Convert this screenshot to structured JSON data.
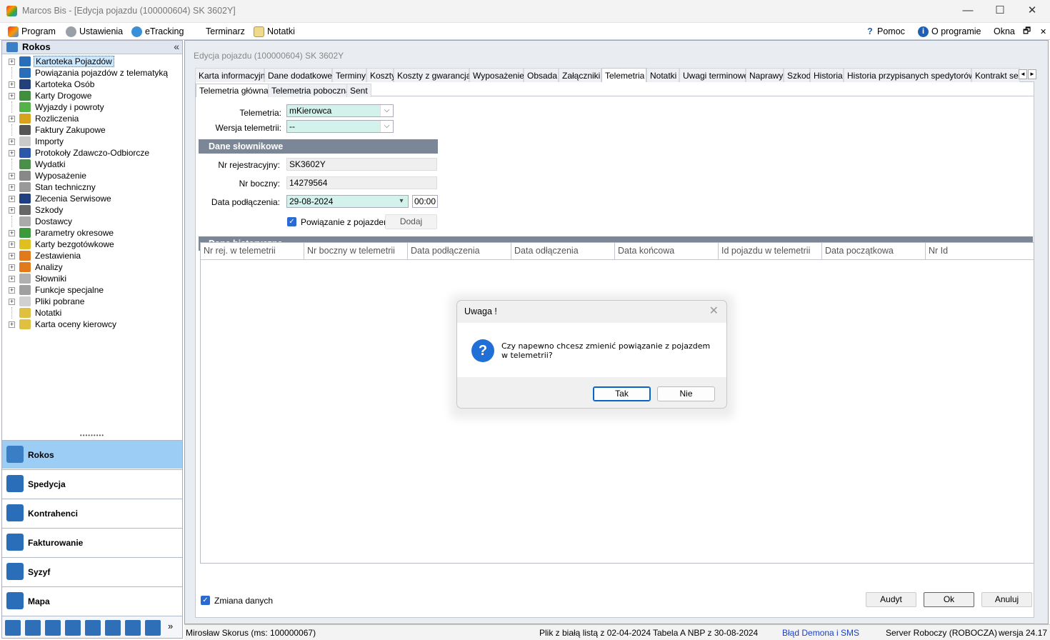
{
  "window": {
    "title": "Marcos Bis - [Edycja pojazdu (100000604) SK 3602Y]",
    "controls": {
      "minimize": "—",
      "maximize": "☐",
      "close": "✕"
    }
  },
  "menu": {
    "left": [
      {
        "label": "Program",
        "icon": "program-icon"
      },
      {
        "label": "Ustawienia",
        "icon": "gear-icon"
      },
      {
        "label": "eTracking",
        "icon": "globe-icon"
      },
      {
        "label": "Terminarz",
        "icon": "calendar-icon"
      },
      {
        "label": "Notatki",
        "icon": "notes-icon"
      }
    ],
    "right": [
      {
        "label": "Pomoc",
        "icon": "help-icon",
        "glyph": "?"
      },
      {
        "label": "O programie",
        "icon": "info-icon",
        "glyph": "i"
      },
      {
        "label": "Okna"
      }
    ],
    "mdi_restore": "🗗",
    "mdi_close": "✕"
  },
  "sidebar": {
    "title": "Rokos",
    "collapse_glyph": "«",
    "tree": [
      {
        "label": "Kartoteka Pojazdów",
        "expandable": true,
        "selected": true,
        "color": "#2a6db8"
      },
      {
        "label": "Powiązania pojazdów z telematyką",
        "expandable": false,
        "color": "#2a6db8"
      },
      {
        "label": "Kartoteka Osób",
        "expandable": true,
        "color": "#24407a"
      },
      {
        "label": "Karty Drogowe",
        "expandable": true,
        "color": "#3f8f3f"
      },
      {
        "label": "Wyjazdy i powroty",
        "expandable": false,
        "color": "#55b24a"
      },
      {
        "label": "Rozliczenia",
        "expandable": true,
        "color": "#d7a21c"
      },
      {
        "label": "Faktury Zakupowe",
        "expandable": false,
        "color": "#555555"
      },
      {
        "label": "Importy",
        "expandable": true,
        "color": "#c9c9c9"
      },
      {
        "label": "Protokoły Zdawczo-Odbiorcze",
        "expandable": true,
        "color": "#2c56a8"
      },
      {
        "label": "Wydatki",
        "expandable": false,
        "color": "#4a8f4a"
      },
      {
        "label": "Wyposażenie",
        "expandable": true,
        "color": "#888888"
      },
      {
        "label": "Stan techniczny",
        "expandable": true,
        "color": "#999999"
      },
      {
        "label": "Zlecenia Serwisowe",
        "expandable": true,
        "color": "#1f3f80"
      },
      {
        "label": "Szkody",
        "expandable": true,
        "color": "#666666"
      },
      {
        "label": "Dostawcy",
        "expandable": false,
        "color": "#aaaaaa"
      },
      {
        "label": "Parametry okresowe",
        "expandable": true,
        "color": "#3c9a3c"
      },
      {
        "label": "Karty bezgotówkowe",
        "expandable": true,
        "color": "#e0c020"
      },
      {
        "label": "Zestawienia",
        "expandable": true,
        "color": "#e07a1a"
      },
      {
        "label": "Analizy",
        "expandable": true,
        "color": "#e07a1a"
      },
      {
        "label": "Słowniki",
        "expandable": true,
        "color": "#b0b0b0"
      },
      {
        "label": "Funkcje specjalne",
        "expandable": true,
        "color": "#a0a0a0"
      },
      {
        "label": "Pliki pobrane",
        "expandable": true,
        "color": "#d0d0d0"
      },
      {
        "label": "Notatki",
        "expandable": false,
        "color": "#e0c040"
      },
      {
        "label": "Karta oceny kierowcy",
        "expandable": true,
        "color": "#e0c040"
      }
    ],
    "splitter": "•••••••••",
    "nav_buttons": [
      {
        "label": "Rokos",
        "active": true
      },
      {
        "label": "Spedycja",
        "active": false
      },
      {
        "label": "Kontrahenci",
        "active": false
      },
      {
        "label": "Fakturowanie",
        "active": false
      },
      {
        "label": "Syzyf",
        "active": false
      },
      {
        "label": "Mapa",
        "active": false
      }
    ],
    "bottom_icons": [
      "chart-icon",
      "vin-icon",
      "stats-icon",
      "document-icon",
      "tools-icon",
      "calculator-icon",
      "fuel-icon",
      "mail-icon"
    ],
    "bottom_more": "»"
  },
  "editor": {
    "title": "Edycja pojazdu (100000604) SK 3602Y",
    "tabs": [
      "Karta informacyjna",
      "Dane dodatkowe",
      "Terminy",
      "Koszty",
      "Koszty z gwarancją",
      "Wyposażenie",
      "Obsada",
      "Załączniki",
      "Telemetria",
      "Notatki",
      "Uwagi terminowe",
      "Naprawy",
      "Szkody",
      "Historia",
      "Historia przypisanych spedytorów",
      "Kontrakt ser"
    ],
    "active_tab": "Telemetria",
    "tab_scroll_left": "◄",
    "tab_scroll_right": "►",
    "subtabs": [
      "Telemetria główna",
      "Telemetria poboczna",
      "Sent"
    ],
    "active_subtab": "Telemetria główna",
    "telemetria_label": "Telemetria:",
    "telemetria_value": "mKierowca",
    "wersja_label": "Wersja telemetrii:",
    "wersja_value": "--",
    "combo_arrow": "⌵",
    "section_slownikowe": "Dane słownikowe",
    "nr_rej_label": "Nr rejestracyjny:",
    "nr_rej_value": "SK3602Y",
    "nr_boczny_label": "Nr boczny:",
    "nr_boczny_value": "14279564",
    "data_podl_label": "Data podłączenia:",
    "data_podl_value": "29-08-2024",
    "data_podl_arrow": "▾",
    "time_value": "00:00",
    "powiazanie_label": "Powiązanie z pojazdem",
    "powiazanie_checked": true,
    "dodaj_label": "Dodaj",
    "section_historyczne": "Dane historyczne",
    "grid_columns": [
      "Nr rej. w telemetrii",
      "Nr boczny w telemetrii",
      "Data podłączenia",
      "Data odłączenia",
      "Data końcowa",
      "Id pojazdu w telemetrii",
      "Data początkowa",
      "Nr Id"
    ],
    "zmiana_label": "Zmiana danych",
    "zmiana_checked": true,
    "check_glyph": "✓",
    "btn_audyt": "Audyt",
    "btn_ok": "Ok",
    "btn_anuluj": "Anuluj"
  },
  "dialog": {
    "title": "Uwaga !",
    "close": "✕",
    "icon": "?",
    "message": "Czy napewno chcesz zmienić powiązanie z pojazdem w telemetrii?",
    "yes": "Tak",
    "no": "Nie"
  },
  "status": {
    "user": "Mirosław Skorus (ms: 100000067)",
    "whitelist": "Plik z białą listą z 02-04-2024",
    "nbp": "Tabela A NBP z 30-08-2024",
    "error_link": "Błąd Demona i SMS",
    "server": "Server Roboczy (ROBOCZA)",
    "version": "wersja 24.17"
  }
}
